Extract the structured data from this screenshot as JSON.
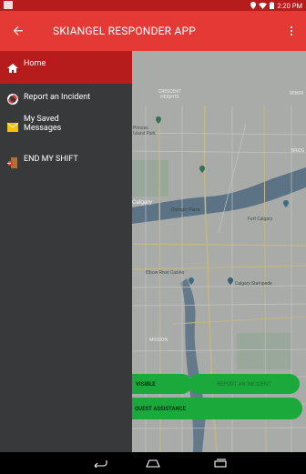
{
  "status": {
    "time": "2:20 PM"
  },
  "app_bar": {
    "title": "SKIANGEL RESPONDER APP"
  },
  "drawer": {
    "items": [
      {
        "label": "Home"
      },
      {
        "label": "Report an Incident"
      },
      {
        "label": "My Saved\nMessages"
      },
      {
        "label": "END MY SHIFT"
      }
    ]
  },
  "map": {
    "labels": {
      "crescent_heights": "CRESCENT\nHEIGHTS",
      "renfrew": "RENFR",
      "princes_island": "Princes\nIsland Park",
      "calgary": "Calgary",
      "olympic_plaza": "Olympic Plaza",
      "fort_calgary": "Fort Calgary",
      "bridgeland": "BRIDG",
      "elbow_river_casino": "Elbow River Casino",
      "calgary_stampede": "Calgary Stampede",
      "mission": "MISSION"
    }
  },
  "actions": {
    "visible": "VISIBLE",
    "report_incident": "REPORT AN INCIDENT",
    "request_assistance": "QUEST ASSISTANCE"
  },
  "colors": {
    "app_bar": "#e53935",
    "status_bar": "#b71c1c",
    "drawer_bg": "#37393a",
    "drawer_active": "#b71c1c",
    "action_green": "#1aa93a"
  }
}
